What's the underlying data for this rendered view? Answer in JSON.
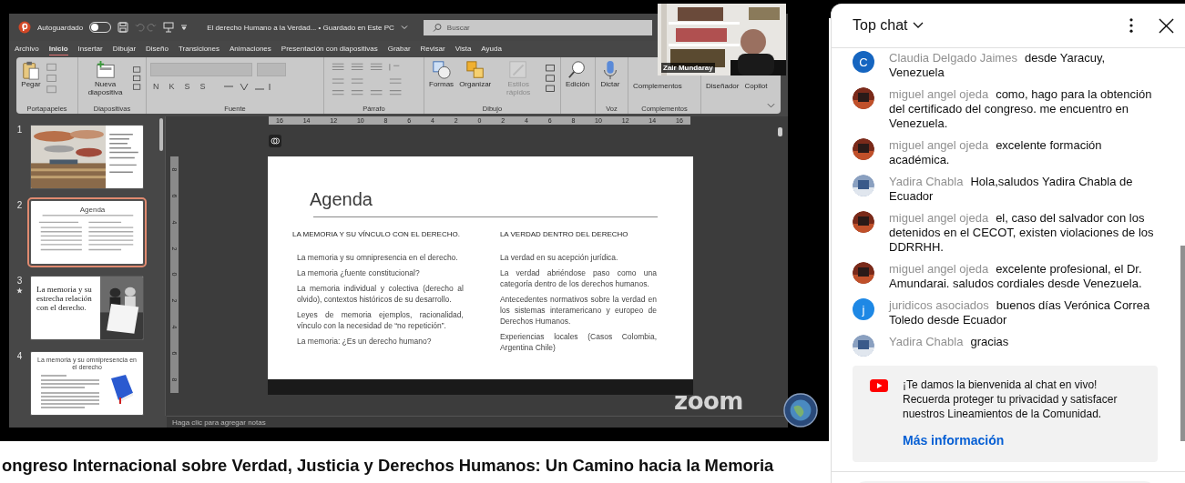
{
  "powerpoint": {
    "autosave_label": "Autoguardado",
    "autosave_on": false,
    "document_title": "El derecho Humano a la Verdad... • Guardado en Este PC",
    "search": {
      "placeholder": "Buscar"
    },
    "tabs": [
      {
        "label": "Archivo",
        "selected": false
      },
      {
        "label": "Inicio",
        "selected": true
      },
      {
        "label": "Insertar",
        "selected": false
      },
      {
        "label": "Dibujar",
        "selected": false
      },
      {
        "label": "Diseño",
        "selected": false
      },
      {
        "label": "Transiciones",
        "selected": false
      },
      {
        "label": "Animaciones",
        "selected": false
      },
      {
        "label": "Presentación con diapositivas",
        "selected": false
      },
      {
        "label": "Grabar",
        "selected": false
      },
      {
        "label": "Revisar",
        "selected": false
      },
      {
        "label": "Vista",
        "selected": false
      },
      {
        "label": "Ayuda",
        "selected": false
      }
    ],
    "ribbon_groups": [
      {
        "label": "Portapapeles",
        "items": [
          {
            "kind": "paste",
            "label": "Pegar",
            "disabled": false
          },
          {
            "kind": "tools",
            "disabled": true
          }
        ]
      },
      {
        "label": "Diapositivas",
        "items": [
          {
            "kind": "new-slide",
            "label": "Nueva diapositiva",
            "disabled": false
          },
          {
            "kind": "layout",
            "disabled": false
          }
        ]
      },
      {
        "label": "Fuente",
        "items": [
          {
            "kind": "font",
            "buttons": [
              "N",
              "K",
              "S",
              "S"
            ],
            "disabled": true
          }
        ]
      },
      {
        "label": "Párrafo",
        "items": [
          {
            "kind": "paragraph",
            "disabled": true
          }
        ]
      },
      {
        "label": "Dibujo",
        "items": [
          {
            "kind": "shapes",
            "label": "Formas",
            "disabled": false
          },
          {
            "kind": "arrange",
            "label": "Organizar",
            "disabled": false
          },
          {
            "kind": "styles",
            "label": "Estilos rápidos",
            "disabled": true
          },
          {
            "kind": "draw-tools",
            "disabled": false
          }
        ]
      },
      {
        "items": [
          {
            "kind": "find",
            "label": "Edición",
            "disabled": false
          }
        ]
      },
      {
        "label": "Voz",
        "items": [
          {
            "kind": "mic",
            "label": "Dictar",
            "disabled": false
          }
        ]
      },
      {
        "label": "Complementos",
        "items": [
          {
            "kind": "addins",
            "label": "Complementos",
            "disabled": false
          }
        ]
      },
      {
        "items": [
          {
            "kind": "designer",
            "label": "Diseñador",
            "disabled": false
          },
          {
            "kind": "copilot",
            "label": "Copilot",
            "disabled": false
          }
        ]
      }
    ],
    "thumbnails": [
      {
        "number": "1",
        "selected": false,
        "kind": "title-picture",
        "transition": false
      },
      {
        "number": "2",
        "selected": true,
        "kind": "agenda",
        "title": "Agenda",
        "transition": false
      },
      {
        "number": "3",
        "selected": false,
        "kind": "text-picture",
        "title": "La memoria y su estrecha relación con el derecho.",
        "transition": true
      },
      {
        "number": "4",
        "selected": false,
        "kind": "text-book",
        "title": "La memoria y su omnipresencia en el derecho",
        "transition": false
      }
    ],
    "ruler_horizontal": [
      "16",
      "14",
      "12",
      "10",
      "8",
      "6",
      "4",
      "2",
      "0",
      "2",
      "4",
      "6",
      "8",
      "10",
      "12",
      "14",
      "16"
    ],
    "ruler_vertical": [
      "8",
      "6",
      "4",
      "2",
      "0",
      "2",
      "4",
      "6",
      "8"
    ],
    "slide": {
      "title": "Agenda",
      "columns": [
        {
          "heading": "LA MEMORIA Y SU VÍNCULO CON EL DERECHO.",
          "items": [
            "La memoria y su omnipresencia en el derecho.",
            "La memoria ¿fuente constitucional?",
            "La memoria individual y colectiva (derecho al olvido), contextos históricos de su desarrollo.",
            "Leyes de memoria ejemplos, racionalidad, vínculo con la necesidad de “no repetición”.",
            "La memoria: ¿Es un derecho humano?"
          ]
        },
        {
          "heading": "LA VERDAD DENTRO DEL DERECHO",
          "items": [
            "La verdad en su acepción jurídica.",
            "La verdad abriéndose paso como una categoría dentro de los derechos humanos.",
            "Antecedentes normativos sobre la verdad en los sistemas interamericano y europeo de Derechos Humanos.",
            "Experiencias locales (Casos Colombia, Argentina Chile)"
          ]
        }
      ]
    },
    "notes": {
      "placeholder": "Haga clic para agregar notas"
    }
  },
  "webcam": {
    "name": "Zair Mundaray"
  },
  "zoom_logo": "zoom",
  "video_title": "ongreso Internacional sobre Verdad, Justicia y Derechos Humanos: Un Camino hacia la Memoria",
  "chat": {
    "title": "Top chat",
    "messages": [
      {
        "author": "Claudia Delgado Jaimes",
        "text": "desde Yaracuy, Venezuela",
        "avatar": {
          "kind": "letter",
          "letter": "C",
          "color": "#1565c0"
        }
      },
      {
        "author": "miguel angel ojeda",
        "text": "como, hago para la obtención del certificado del congreso. me encuentro en Venezuela."
      },
      {
        "author": "miguel angel ojeda",
        "text": "excelente formación académica."
      },
      {
        "author": "Yadira Chabla",
        "text": "Hola,saludos Yadira Chabla de Ecuador"
      },
      {
        "author": "miguel angel ojeda",
        "text": "el, caso del salvador con los detenidos en el CECOT, existen violaciones de los DDRRHH."
      },
      {
        "author": "miguel angel ojeda",
        "text": "excelente profesional, el Dr. Amundarai. saludos cordiales desde Venezuela."
      },
      {
        "author": "juridicos asociados",
        "text": "buenos días Verónica Correa Toledo desde Ecuador",
        "avatar": {
          "kind": "letter",
          "letter": "j",
          "color": "#1e88e5"
        }
      },
      {
        "author": "Yadira Chabla",
        "text": "gracias"
      }
    ],
    "welcome": {
      "text": "¡Te damos la bienvenida al chat en vivo! Recuerda proteger tu privacidad y satisfacer nuestros Lineamientos de la Comunidad.",
      "link": "Más información"
    }
  }
}
